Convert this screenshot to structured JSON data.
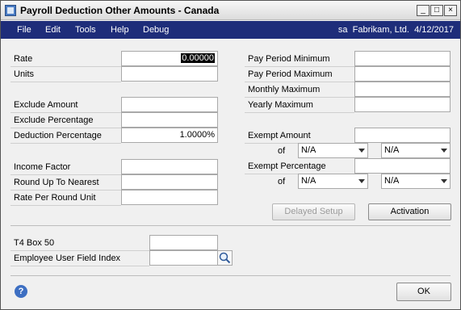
{
  "window": {
    "title": "Payroll Deduction Other Amounts - Canada",
    "controls": {
      "minimize": "_",
      "maximize": "□",
      "close": "×"
    }
  },
  "menu": {
    "items": [
      "File",
      "Edit",
      "Tools",
      "Help",
      "Debug"
    ],
    "user": "sa",
    "company": "Fabrikam, Ltd.",
    "date": "4/12/2017"
  },
  "left_fields": {
    "rate": {
      "label": "Rate",
      "value": "0.00000"
    },
    "units": {
      "label": "Units",
      "value": ""
    },
    "exclude_amount": {
      "label": "Exclude Amount",
      "value": ""
    },
    "exclude_percentage": {
      "label": "Exclude Percentage",
      "value": ""
    },
    "deduction_percentage": {
      "label": "Deduction Percentage",
      "value": "1.0000%"
    },
    "income_factor": {
      "label": "Income Factor",
      "value": ""
    },
    "round_up_to_nearest": {
      "label": "Round Up To Nearest",
      "value": ""
    },
    "rate_per_round_unit": {
      "label": "Rate Per Round Unit",
      "value": ""
    }
  },
  "right_fields": {
    "pay_period_minimum": {
      "label": "Pay Period Minimum",
      "value": ""
    },
    "pay_period_maximum": {
      "label": "Pay Period Maximum",
      "value": ""
    },
    "monthly_maximum": {
      "label": "Monthly Maximum",
      "value": ""
    },
    "yearly_maximum": {
      "label": "Yearly Maximum",
      "value": ""
    },
    "exempt_amount": {
      "label": "Exempt Amount",
      "value": "",
      "of_label": "of",
      "dropdown1": "N/A",
      "dropdown2": "N/A"
    },
    "exempt_percentage": {
      "label": "Exempt Percentage",
      "value": "",
      "of_label": "of",
      "dropdown1": "N/A",
      "dropdown2": "N/A"
    }
  },
  "buttons": {
    "delayed_setup": "Delayed Setup",
    "activation": "Activation",
    "ok": "OK"
  },
  "bottom_fields": {
    "t4_box_50": {
      "label": "T4 Box 50",
      "value": ""
    },
    "employee_user_field_index": {
      "label": "Employee User Field Index",
      "value": ""
    }
  },
  "icons": {
    "app": "app-icon",
    "help": "help-icon",
    "lookup": "magnifier-icon"
  }
}
